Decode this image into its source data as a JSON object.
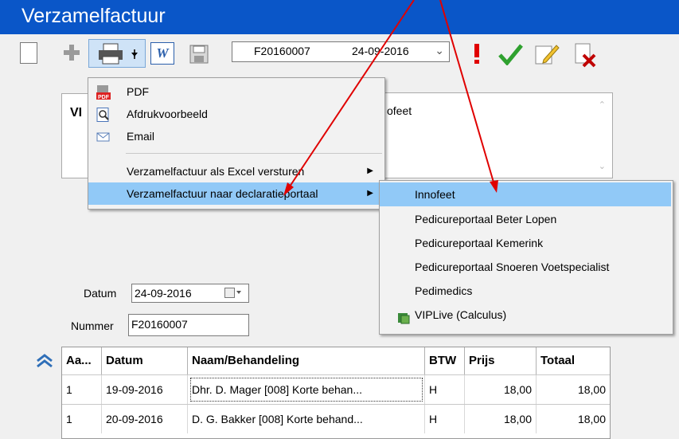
{
  "window": {
    "title": "Verzamelfactuur"
  },
  "toolbar": {
    "invoice_number": "F20160007",
    "invoice_date": "24-09-2016",
    "icons": [
      "new-icon",
      "add-icon",
      "print-icon",
      "word-icon",
      "save-icon",
      "alert-icon",
      "check-icon",
      "edit-icon",
      "delete-icon"
    ]
  },
  "customer": {
    "name_prefix": "VI"
  },
  "notes": {
    "text": "ofeet"
  },
  "form": {
    "datum_label": "Datum",
    "datum_value": "24-09-2016",
    "nummer_label": "Nummer",
    "nummer_value": "F20160007"
  },
  "print_menu": {
    "items": [
      {
        "label": "PDF",
        "icon": "pdf-icon"
      },
      {
        "label": "Afdrukvoorbeeld",
        "icon": "preview-icon"
      },
      {
        "label": "Email",
        "icon": "email-icon"
      },
      {
        "label": "Verzamelfactuur als Excel versturen",
        "submenu": true
      },
      {
        "label": "Verzamelfactuur naar declaratieportaal",
        "submenu": true,
        "highlighted": true
      }
    ]
  },
  "portal_menu": {
    "items": [
      {
        "label": "Innofeet",
        "highlighted": true
      },
      {
        "label": "Pedicureportaal Beter Lopen"
      },
      {
        "label": "Pedicureportaal Kemerink"
      },
      {
        "label": "Pedicureportaal Snoeren Voetspecialist"
      },
      {
        "label": "Pedimedics"
      },
      {
        "label": "VIPLive (Calculus)",
        "icon": "viplive-icon"
      }
    ]
  },
  "table": {
    "columns": [
      "Aa...",
      "Datum",
      "Naam/Behandeling",
      "BTW",
      "Prijs",
      "Totaal"
    ],
    "rows": [
      [
        "1",
        "19-09-2016",
        "Dhr. D. Mager [008] Korte behan...",
        "H",
        "18,00",
        "18,00"
      ],
      [
        "1",
        "20-09-2016",
        "D. G. Bakker [008] Korte behand...",
        "H",
        "18,00",
        "18,00"
      ]
    ]
  },
  "colors": {
    "titlebar": "#0a56c8",
    "highlight": "#91c9f7",
    "annotation_arrow": "#e00000"
  }
}
